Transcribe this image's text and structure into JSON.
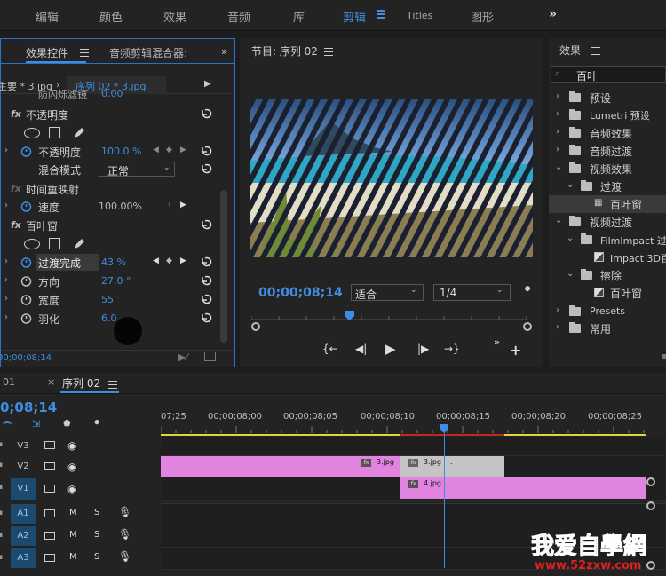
{
  "workspaces": {
    "items": [
      "编辑",
      "颜色",
      "效果",
      "音频",
      "库",
      "剪辑",
      "Titles",
      "图形"
    ],
    "active": "剪辑",
    "more": "»"
  },
  "effect_controls": {
    "tab_active": "效果控件",
    "tab_other": "音频剪辑混合器: ",
    "clip_path_left": "主要 * 3.jpg",
    "clip_path_right": "序列 02 * 3.jpg",
    "rows": {
      "anti_flicker": {
        "label": "防闪烁滤镜",
        "value": "0.00"
      },
      "opacity_group": {
        "label": "不透明度"
      },
      "opacity": {
        "label": "不透明度",
        "value": "100.0 %"
      },
      "blend_mode": {
        "label": "混合模式",
        "value": "正常"
      },
      "time_remap": {
        "label": "时间重映射"
      },
      "speed": {
        "label": "速度",
        "value": "100.00%"
      },
      "venetian": {
        "label": "百叶窗"
      },
      "transition": {
        "label": "过渡完成",
        "value": "43 %"
      },
      "direction": {
        "label": "方向",
        "value": "27.0 °"
      },
      "width": {
        "label": "宽度",
        "value": "55"
      },
      "feather": {
        "label": "羽化",
        "value": "6.0"
      }
    },
    "timecode": "00;00;08;14"
  },
  "program": {
    "title": "节目: 序列 02",
    "timecode": "00;00;08;14",
    "fit": "适合",
    "resolution": "1/4"
  },
  "effects_browser": {
    "title": "效果",
    "search": "百叶",
    "items": [
      {
        "label": "预设"
      },
      {
        "label": "Lumetri 预设"
      },
      {
        "label": "音频效果"
      },
      {
        "label": "音频过渡"
      },
      {
        "label": "视频效果"
      },
      {
        "label": "过渡"
      },
      {
        "label": "百叶窗"
      },
      {
        "label": "视频过渡"
      },
      {
        "label": "FilmImpact 过"
      },
      {
        "label": "Impact 3D百"
      },
      {
        "label": "擦除"
      },
      {
        "label": "百叶窗"
      },
      {
        "label": "Presets"
      },
      {
        "label": "常用"
      }
    ]
  },
  "timeline": {
    "tab_prev": "01",
    "tab_active": "序列 02",
    "timecode": "0;08;14",
    "ruler": [
      "07;25",
      "00;00;08;00",
      "00;00;08;05",
      "00;00;08;10",
      "00;00;08;15",
      "00;00;08;20",
      "00;00;08;25"
    ],
    "tracks": {
      "v3": "V3",
      "v2": "V2",
      "v1": "V1",
      "a1": "A1",
      "a2": "A2",
      "a3": "A3",
      "m": "M",
      "s": "S"
    },
    "clips": {
      "v2_a": "3.jpg",
      "v2_b": "3.jpg",
      "v1_a": "4.jpg",
      "dot": "."
    }
  },
  "watermark": {
    "brand": "我爱自學網",
    "url": "www.52zxw.com"
  },
  "colors": {
    "accent": "#3f8de0",
    "clip_pink": "#e184e0",
    "clip_gray": "#c4c4c4",
    "work_yellow": "#e3d23a",
    "work_red": "#c02626"
  }
}
